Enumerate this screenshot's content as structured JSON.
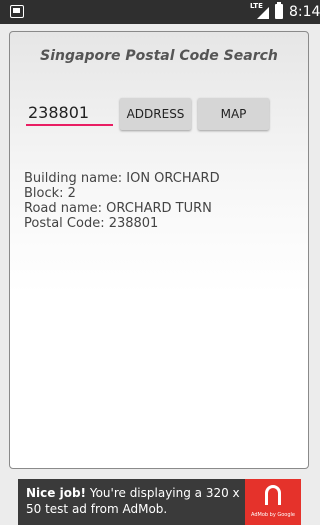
{
  "status_bar": {
    "time": "8:14",
    "network": "LTE",
    "icons": [
      "app-icon",
      "signal-icon",
      "battery-icon"
    ]
  },
  "app": {
    "title": "Singapore Postal Code Search",
    "postal_input": {
      "value": "238801",
      "placeholder": ""
    },
    "buttons": {
      "address_label": "ADDRESS",
      "map_label": "MAP"
    },
    "accent_color": "#e91e63",
    "result": {
      "building": "Building name: ION ORCHARD",
      "block": "Block: 2",
      "road": "Road name: ORCHARD TURN",
      "postal": "Postal Code: 238801"
    }
  },
  "ad": {
    "headline": "Nice job!",
    "body": "You're displaying a 320 x 50 test ad from AdMob.",
    "logo_caption": "AdMob by Google",
    "logo_color": "#e5322b"
  }
}
